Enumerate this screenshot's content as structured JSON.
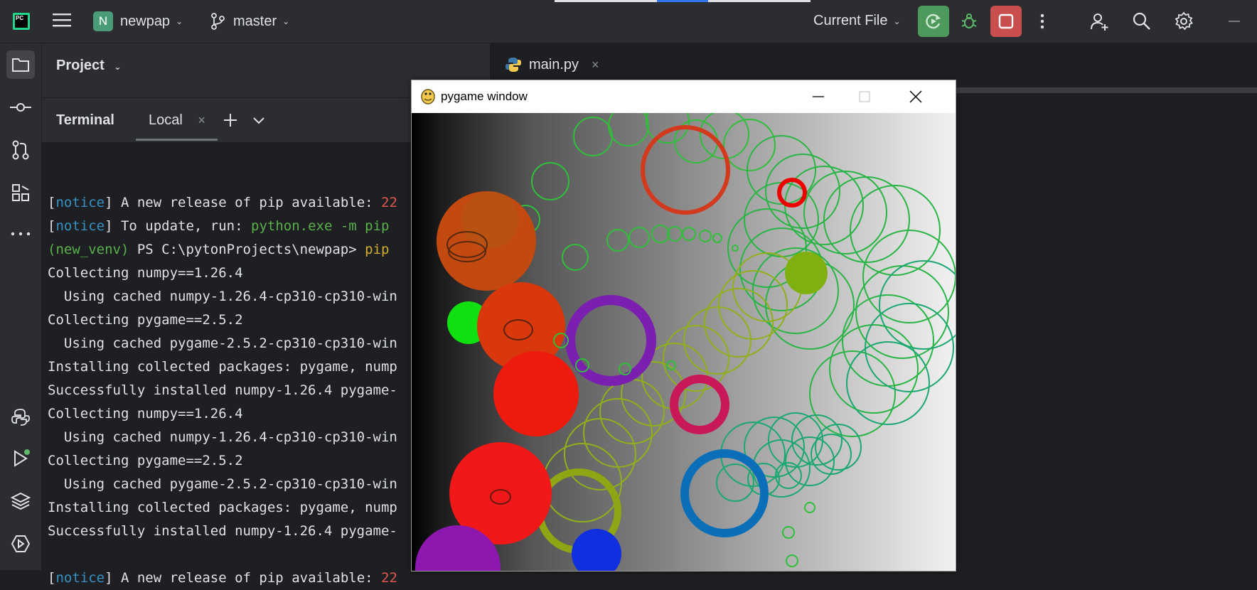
{
  "titlebar": {
    "project_badge": "N",
    "project_name": "newpap",
    "branch": "master",
    "run_config": "Current File"
  },
  "project_pane": {
    "title": "Project"
  },
  "editor": {
    "tab_label": "main.py"
  },
  "terminal": {
    "title": "Terminal",
    "tab_label": "Local",
    "lines": [
      [
        {
          "t": ""
        }
      ],
      [
        {
          "t": "["
        },
        {
          "t": "notice",
          "c": "c-blue"
        },
        {
          "t": "] A new release of pip available: "
        },
        {
          "t": "22",
          "c": "c-red"
        }
      ],
      [
        {
          "t": "["
        },
        {
          "t": "notice",
          "c": "c-blue"
        },
        {
          "t": "] To update, run: "
        },
        {
          "t": "python.exe -m pip",
          "c": "c-green"
        }
      ],
      [
        {
          "t": "(new_venv)",
          "c": "c-green"
        },
        {
          "t": " PS C:\\pytonProjects\\newpap> "
        },
        {
          "t": "pip",
          "c": "c-yellow"
        }
      ],
      [
        {
          "t": "Collecting numpy==1.26.4"
        }
      ],
      [
        {
          "t": "  Using cached numpy-1.26.4-cp310-cp310-win"
        }
      ],
      [
        {
          "t": "Collecting pygame==2.5.2"
        }
      ],
      [
        {
          "t": "  Using cached pygame-2.5.2-cp310-cp310-win"
        }
      ],
      [
        {
          "t": "Installing collected packages: pygame, nump"
        }
      ],
      [
        {
          "t": "Successfully installed numpy-1.26.4 pygame-"
        }
      ],
      [
        {
          "t": "Collecting numpy==1.26.4"
        }
      ],
      [
        {
          "t": "  Using cached numpy-1.26.4-cp310-cp310-win"
        }
      ],
      [
        {
          "t": "Collecting pygame==2.5.2"
        }
      ],
      [
        {
          "t": "  Using cached pygame-2.5.2-cp310-cp310-win"
        }
      ],
      [
        {
          "t": "Installing collected packages: pygame, nump"
        }
      ],
      [
        {
          "t": "Successfully installed numpy-1.26.4 pygame-"
        }
      ],
      [
        {
          "t": ""
        }
      ],
      [
        {
          "t": "["
        },
        {
          "t": "notice",
          "c": "c-blue"
        },
        {
          "t": "] A new release of pip available: "
        },
        {
          "t": "22",
          "c": "c-red"
        }
      ]
    ]
  },
  "pygame_window": {
    "title": "pygame window"
  },
  "colors": {
    "accent_green": "#4e9a5c",
    "stop_red": "#c94f4f",
    "bg_dark": "#1e1f22",
    "panel": "#2b2d30"
  }
}
